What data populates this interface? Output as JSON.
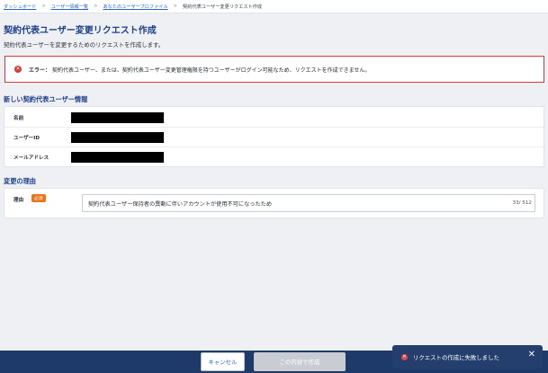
{
  "breadcrumb": {
    "items": [
      "ダッシュボード",
      "ユーザー情報一覧",
      "あなたのユーザープロファイル"
    ],
    "current": "契約代表ユーザー変更リクエスト作成",
    "separator": ">"
  },
  "page": {
    "title": "契約代表ユーザー変更リクエスト作成",
    "description": "契約代表ユーザーを変更するためのリクエストを作成します。"
  },
  "error": {
    "label": "エラー：",
    "message": "契約代表ユーザー、または、契約代表ユーザー変更管理権限を持つユーザーがログイン可能なため、リクエストを作成できません。",
    "color": "#d63a3a"
  },
  "new_user_section": {
    "title": "新しい契約代表ユーザー情報",
    "rows": [
      {
        "label": "名前"
      },
      {
        "label": "ユーザーID"
      },
      {
        "label": "メールアドレス"
      }
    ]
  },
  "reason_section": {
    "title": "変更の理由",
    "label": "理由",
    "required_badge": "必須",
    "value": "契約代表ユーザー保持者の異動に伴いアカウントが使用不可になったため",
    "char_count": "33/ 512"
  },
  "actions": {
    "cancel_label": "キャンセル",
    "submit_label": "この内容で作成"
  },
  "toast": {
    "message": "リクエストの作成に失敗しました"
  },
  "colors": {
    "accent": "#1c3f8a",
    "link": "#2b66c6",
    "badge": "#e8741c",
    "footer": "#1e3a6b"
  }
}
